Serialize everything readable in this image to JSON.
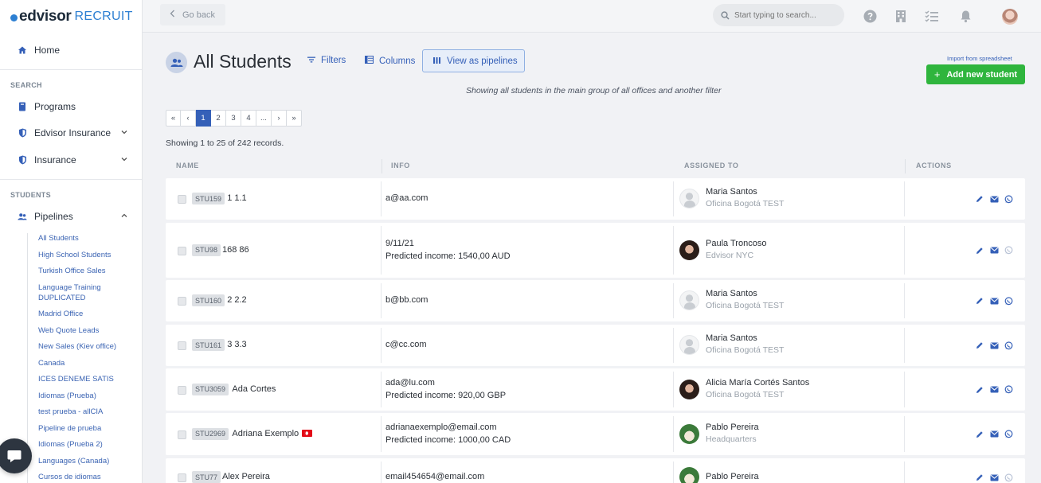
{
  "brand": {
    "logo_main": "edvisor",
    "logo_sub": "RECRUIT"
  },
  "sidebar": {
    "home": "Home",
    "search_label": "SEARCH",
    "search_items": [
      {
        "label": "Programs"
      },
      {
        "label": "Edvisor Insurance"
      },
      {
        "label": "Insurance"
      }
    ],
    "students_label": "STUDENTS",
    "pipelines": "Pipelines",
    "pipeline_items": [
      "All Students",
      "High School Students",
      "Turkish Office Sales",
      "Language Training DUPLICATED",
      "Madrid Office",
      "Web Quote Leads",
      "New Sales (Kiev office)",
      "Canada",
      "ICES DENEME SATIS",
      "Idiomas (Prueba)",
      "test prueba - allCIA",
      "Pipeline de prueba",
      "Idiomas (Prueba 2)",
      "Languages (Canada)",
      "Cursos de idiomas"
    ]
  },
  "topbar": {
    "go_back": "Go back",
    "search_placeholder": "Start typing to search..."
  },
  "header": {
    "title": "All Students",
    "filters": "Filters",
    "columns": "Columns",
    "view_pipelines": "View as pipelines",
    "import": "Import from spreadsheet",
    "add_student": "Add new student",
    "filter_desc": "Showing all students in the main group of all offices and another filter"
  },
  "pagination": {
    "first": "«",
    "prev": "‹",
    "pages": [
      "1",
      "2",
      "3",
      "4",
      "..."
    ],
    "next": "›",
    "last": "»",
    "current": "1"
  },
  "records": "Showing 1 to 25 of 242 records.",
  "table": {
    "headers": {
      "name": "NAME",
      "info": "INFO",
      "assigned": "ASSIGNED TO",
      "actions": "ACTIONS"
    },
    "rows": [
      {
        "id": "STU159",
        "name": "1 1.1",
        "info1": "a@aa.com",
        "income_label": "",
        "income": "",
        "assignee": "Maria Santos",
        "office": "Oficina Bogotá TEST",
        "avatar": "gray"
      },
      {
        "id": "STU98",
        "name": "168 86",
        "info1": "9/11/21",
        "income_label": "Predicted income: ",
        "income": "1540,00 AUD",
        "assignee": "Paula Troncoso",
        "office": "Edvisor NYC",
        "avatar": "dark"
      },
      {
        "id": "STU160",
        "name": "2 2.2",
        "info1": "b@bb.com",
        "income_label": "",
        "income": "",
        "assignee": "Maria Santos",
        "office": "Oficina Bogotá TEST",
        "avatar": "gray"
      },
      {
        "id": "STU161",
        "name": "3 3.3",
        "info1": "c@cc.com",
        "income_label": "",
        "income": "",
        "assignee": "Maria Santos",
        "office": "Oficina Bogotá TEST",
        "avatar": "gray"
      },
      {
        "id": "STU3059",
        "name": "Ada Cortes",
        "info1": "ada@lu.com",
        "income_label": "Predicted income: ",
        "income": "920,00 GBP",
        "assignee": "Alicia María Cortés Santos",
        "office": "Oficina Bogotá TEST",
        "avatar": "dark"
      },
      {
        "id": "STU2969",
        "name": "Adriana Exemplo",
        "info1": "adrianaexemplo@email.com",
        "income_label": "Predicted income: ",
        "income": "1000,00 CAD",
        "assignee": "Pablo Pereira",
        "office": "Headquarters",
        "avatar": "dog"
      },
      {
        "id": "STU77",
        "name": "Alex Pereira",
        "info1": "email454654@email.com",
        "income_label": "",
        "income": "",
        "assignee": "Pablo Pereira",
        "office": "",
        "avatar": "dog"
      }
    ]
  },
  "colors": {
    "accent": "#3560b8",
    "success": "#2fb53d",
    "whatsapp_disabled": "#b9c3d6"
  }
}
